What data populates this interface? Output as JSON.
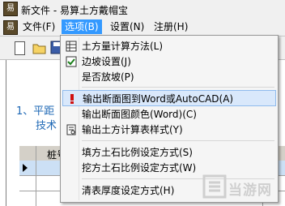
{
  "window": {
    "title": "新文件 - 易算土方戴帽宝"
  },
  "menubar": {
    "items": [
      {
        "label": "文件(F)"
      },
      {
        "label": "选项(B)"
      },
      {
        "label": "设置(N)"
      },
      {
        "label": "注册(H)"
      }
    ]
  },
  "document": {
    "line1": "1、平距",
    "line2": "技术",
    "grid_header_col1": "桩号"
  },
  "dropdown": {
    "items": [
      {
        "label": "土方量计算方法(L)",
        "icon": "table-icon"
      },
      {
        "label": "边坡设置(J)",
        "icon": "checkbox-icon"
      },
      {
        "label": "是否放坡(P)",
        "icon": ""
      },
      {
        "label": "输出断面图到Word或AutoCAD(A)",
        "icon": "exclamation-icon"
      },
      {
        "label": "输出断面图颜色(Word)(C)",
        "icon": ""
      },
      {
        "label": "输出土方计算表样式(Y)",
        "icon": "document-icon"
      },
      {
        "label": "填方土石比例设定方式(S)",
        "icon": ""
      },
      {
        "label": "挖方土石比例设定方式(W)",
        "icon": ""
      },
      {
        "label": "清表厚度设定方式(H)",
        "icon": ""
      }
    ]
  },
  "watermark": {
    "text": "当游网"
  },
  "colors": {
    "menu_active": "#3399ff",
    "highlight": "#d9e8fb",
    "doc_text": "#1e68b5"
  }
}
